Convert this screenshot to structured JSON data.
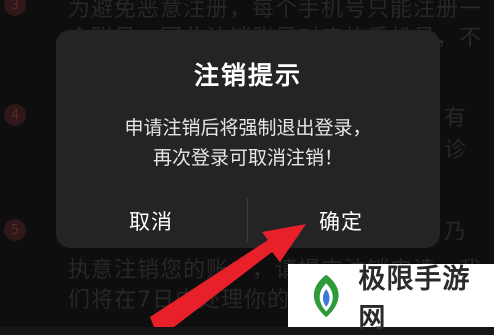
{
  "background": {
    "steps": [
      "3",
      "4",
      "5"
    ],
    "lines": [
      "为避免恶意注册，每个手机号只能注册一",
      "个账号，因此注销账号对应的手机号，不",
      "有",
      "诊",
      "乃",
      "执意注销您的账户，请提交注销申请，我",
      "们将在7日内处理你的注销"
    ]
  },
  "dialog": {
    "title": "注销提示",
    "message_line1": "申请注销后将强制退出登录，",
    "message_line2": "再次登录可取消注销！",
    "cancel_label": "取消",
    "confirm_label": "确定"
  },
  "annotation": {
    "arrow_color": "#e8202a",
    "arrow_icon": "red-arrow-icon"
  },
  "watermark": {
    "text": "极限手游网",
    "icon": "watermark-logo-icon"
  }
}
